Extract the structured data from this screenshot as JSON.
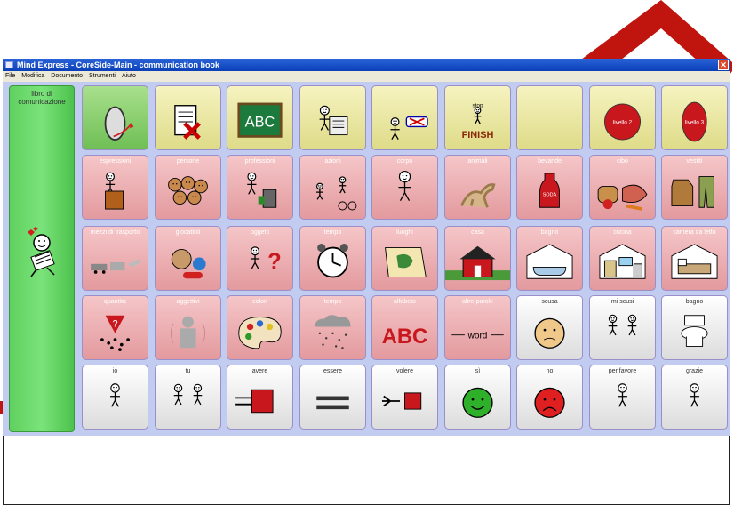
{
  "window": {
    "title": "Mind Express - CoreSide-Main - communication book",
    "close_glyph": "✕"
  },
  "menu": [
    "File",
    "Modifica",
    "Documento",
    "Strumenti",
    "Aiuto"
  ],
  "sidebar": {
    "label": "libro di comunicazione",
    "icon": "child-reading-icon"
  },
  "colors": {
    "green": "#6fbf55",
    "yellow": "#dedb88",
    "pink": "#e39a9e",
    "white": "#dcdcdc",
    "arrow": "#c0150e"
  },
  "grid": [
    [
      {
        "label": "",
        "style": "g",
        "icon": "turn-back-icon"
      },
      {
        "label": "",
        "style": "y",
        "icon": "delete-page-icon"
      },
      {
        "label": "",
        "style": "y",
        "icon": "abc-board-icon"
      },
      {
        "label": "",
        "style": "y",
        "icon": "reading-newspaper-icon"
      },
      {
        "label": "",
        "style": "y",
        "icon": "keyboard-person-icon"
      },
      {
        "label": "",
        "style": "y",
        "icon": "finish-icon",
        "caption": "FINISH",
        "small": "stop"
      },
      {
        "label": "",
        "style": "y",
        "icon": "blank-icon"
      },
      {
        "label": "",
        "style": "y",
        "icon": "red-circle-icon",
        "caption": "livello 2"
      },
      {
        "label": "",
        "style": "y",
        "icon": "red-ellipse-icon",
        "caption": "livello 3"
      }
    ],
    [
      {
        "label": "espressioni",
        "style": "p",
        "icon": "speaker-podium-icon"
      },
      {
        "label": "persone",
        "style": "p",
        "icon": "people-faces-icon"
      },
      {
        "label": "professioni",
        "style": "p",
        "icon": "worker-icon"
      },
      {
        "label": "azioni",
        "style": "p",
        "icon": "actions-icon"
      },
      {
        "label": "corpo",
        "style": "p",
        "icon": "body-icon"
      },
      {
        "label": "animali",
        "style": "p",
        "icon": "animals-icon"
      },
      {
        "label": "bevande",
        "style": "p",
        "icon": "soda-bottle-icon",
        "caption": "SODA"
      },
      {
        "label": "cibo",
        "style": "p",
        "icon": "food-icon"
      },
      {
        "label": "vestiti",
        "style": "p",
        "icon": "clothes-icon"
      }
    ],
    [
      {
        "label": "mezzi di trasporto",
        "style": "p",
        "icon": "vehicles-icon"
      },
      {
        "label": "giocattoli",
        "style": "p",
        "icon": "toys-icon"
      },
      {
        "label": "oggetti",
        "style": "p",
        "icon": "question-person-icon"
      },
      {
        "label": "tempo",
        "style": "p",
        "icon": "alarm-clock-icon"
      },
      {
        "label": "luoghi",
        "style": "p",
        "icon": "map-icon"
      },
      {
        "label": "casa",
        "style": "p",
        "icon": "house-icon"
      },
      {
        "label": "bagno",
        "style": "p",
        "icon": "bathtub-icon"
      },
      {
        "label": "cucina",
        "style": "p",
        "icon": "kitchen-icon"
      },
      {
        "label": "camera da letto",
        "style": "p",
        "icon": "bedroom-icon"
      }
    ],
    [
      {
        "label": "quantità",
        "style": "p",
        "icon": "quantity-icon"
      },
      {
        "label": "aggettivi",
        "style": "p",
        "icon": "adjective-icon"
      },
      {
        "label": "colori",
        "style": "p",
        "icon": "palette-icon"
      },
      {
        "label": "tempo",
        "style": "p",
        "icon": "weather-icon"
      },
      {
        "label": "alfabeto",
        "style": "p",
        "icon": "abc-icon",
        "caption": "ABC"
      },
      {
        "label": "altre parole",
        "style": "p",
        "icon": "word-icon",
        "caption": "word"
      },
      {
        "label": "scusa",
        "style": "w",
        "icon": "sad-face-icon"
      },
      {
        "label": "mi scusi",
        "style": "w",
        "icon": "two-people-icon"
      },
      {
        "label": "bagno",
        "style": "w",
        "icon": "toilet-icon"
      }
    ],
    [
      {
        "label": "io",
        "style": "w",
        "icon": "person-self-icon"
      },
      {
        "label": "tu",
        "style": "w",
        "icon": "person-you-icon"
      },
      {
        "label": "avere",
        "style": "w",
        "icon": "have-box-icon"
      },
      {
        "label": "essere",
        "style": "w",
        "icon": "equals-icon"
      },
      {
        "label": "volere",
        "style": "w",
        "icon": "want-box-icon"
      },
      {
        "label": "sì",
        "style": "w",
        "icon": "green-smile-icon"
      },
      {
        "label": "no",
        "style": "w",
        "icon": "red-frown-icon"
      },
      {
        "label": "per favore",
        "style": "w",
        "icon": "please-person-icon"
      },
      {
        "label": "grazie",
        "style": "w",
        "icon": "thanks-person-icon"
      }
    ]
  ]
}
